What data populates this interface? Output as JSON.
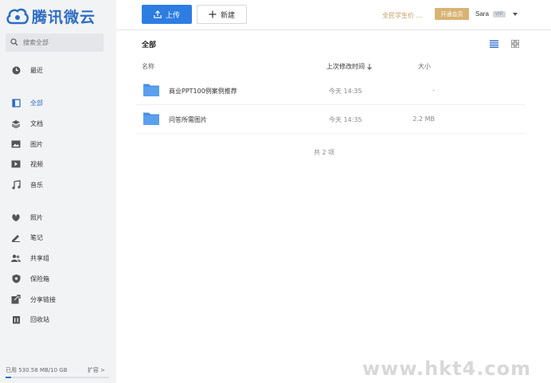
{
  "app": {
    "logo_text": "腾讯微云",
    "brand_color": "#2d6dc4"
  },
  "search": {
    "placeholder": "搜索全部"
  },
  "sidebar": {
    "recent": {
      "label": "最近",
      "icon": "clock-icon"
    },
    "items": [
      {
        "label": "全部",
        "icon": "all-files-icon",
        "active": true
      },
      {
        "label": "文档",
        "icon": "layers-icon"
      },
      {
        "label": "图片",
        "icon": "image-icon"
      },
      {
        "label": "视频",
        "icon": "video-icon"
      },
      {
        "label": "音乐",
        "icon": "music-note-icon"
      }
    ],
    "extras": [
      {
        "label": "照片",
        "icon": "photo-leaf-icon"
      },
      {
        "label": "笔记",
        "icon": "pen-icon"
      },
      {
        "label": "共享组",
        "icon": "group-icon"
      },
      {
        "label": "保险箱",
        "icon": "shield-icon"
      },
      {
        "label": "分享链接",
        "icon": "share-link-icon"
      },
      {
        "label": "回收站",
        "icon": "trash-icon"
      }
    ],
    "storage": {
      "used_text": "已用 530.58 MB/10 GB",
      "expand_label": "扩容 >",
      "used_fraction": 0.052
    }
  },
  "toolbar": {
    "upload_label": "上传",
    "new_label": "新建",
    "promo_text": "全民学生价 ...",
    "vip_button_label": "开通会员",
    "username": "Sara",
    "vip_badge": "VIP"
  },
  "main": {
    "breadcrumb": "全部",
    "columns": {
      "name": "名称",
      "time": "上次修改时间",
      "size": "大小"
    },
    "rows": [
      {
        "name": "商业PPT100例案例推荐",
        "time": "今天 14:35",
        "size": "-"
      },
      {
        "name": "问答所需图片",
        "time": "今天 14:35",
        "size": "2.2 MB"
      }
    ],
    "count_text": "共 2 项"
  },
  "watermark": "www.hkt4.com"
}
